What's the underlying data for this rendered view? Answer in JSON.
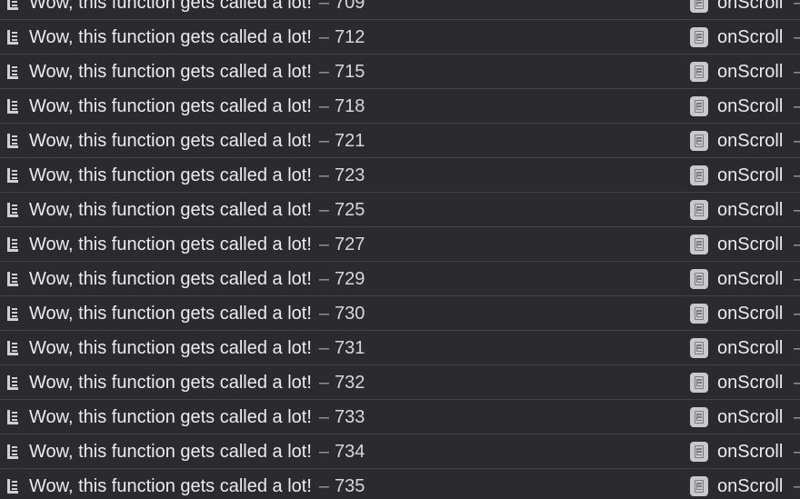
{
  "console": {
    "message_text": "Wow, this function gets called a lot!",
    "separator": "–",
    "source_name": "onScroll",
    "source_suffix": "–",
    "rows": [
      {
        "count": "709"
      },
      {
        "count": "712"
      },
      {
        "count": "715"
      },
      {
        "count": "718"
      },
      {
        "count": "721"
      },
      {
        "count": "723"
      },
      {
        "count": "725"
      },
      {
        "count": "727"
      },
      {
        "count": "729"
      },
      {
        "count": "730"
      },
      {
        "count": "731"
      },
      {
        "count": "732"
      },
      {
        "count": "733"
      },
      {
        "count": "734"
      },
      {
        "count": "735"
      }
    ],
    "icons": {
      "row_icon": "log-message-icon",
      "source_icon": "javascript-file-icon"
    }
  }
}
